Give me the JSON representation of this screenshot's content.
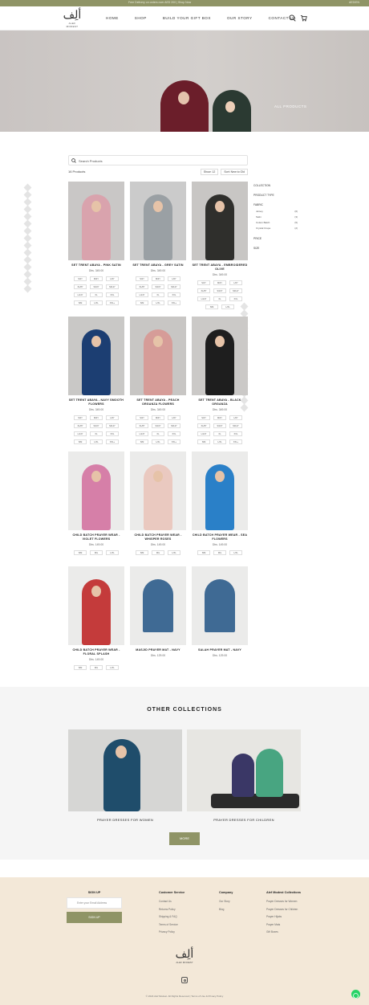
{
  "topbar": {
    "message": "Free Delivery on orders over AED 200 | Shop Now",
    "currency": "AED/EN"
  },
  "header": {
    "logo_arabic": "ألِف",
    "logo_english": "ALEF MODEST",
    "nav": [
      "HOME",
      "SHOP",
      "BUILD YOUR GIFT BOX",
      "OUR STORY",
      "CONTACT US"
    ],
    "icons": [
      "search-icon",
      "cart-icon"
    ]
  },
  "hero": {
    "title": "ALL PRODUCTS"
  },
  "search": {
    "placeholder": "Search Products"
  },
  "listing": {
    "count": "16 Products",
    "sort_label": "Show: 12",
    "sort_order": "Sort: New to Old"
  },
  "filters": {
    "collection": "COLLECTION",
    "product_type": "PRODUCT TYPE",
    "fabric": "FABRIC",
    "fabric_options": [
      {
        "label": "Jersey",
        "count": "(6)"
      },
      {
        "label": "Satin",
        "count": "(3)"
      },
      {
        "label": "Cotton Batch",
        "count": "(5)"
      },
      {
        "label": "Crystal Crepe",
        "count": "(2)"
      }
    ],
    "price": "PRICE",
    "size": "SIZE"
  },
  "products": [
    {
      "name": "SET TRENT ABAYA - PINK SATIN",
      "price": "Dhs. 349.00",
      "sizes": [
        "S/2Y",
        "M/4Y",
        "L/6Y",
        "XL/8Y",
        "S/10Y",
        "M/12Y",
        "L/14Y",
        "XL",
        "XXL",
        "S/M",
        "L/XL",
        "XXL+"
      ],
      "color": "#d9a3ad",
      "bg": "#c9c7c6"
    },
    {
      "name": "SET TRENT ABAYA - GREY SATIN",
      "price": "Dhs. 349.00",
      "sizes": [
        "S/2Y",
        "M/4Y",
        "L/6Y",
        "XL/8Y",
        "S/10Y",
        "M/12Y",
        "L/14Y",
        "XL",
        "XXL",
        "S/M",
        "L/XL",
        "XXL+"
      ],
      "color": "#9aa0a4",
      "bg": "#cbcbcb"
    },
    {
      "name": "SET TRENT ABAYA - EMBROIDERED OLIVE",
      "price": "Dhs. 349.00",
      "sizes": [
        "S/2Y",
        "M/4Y",
        "L/6Y",
        "XL/8Y",
        "S/10Y",
        "M/12Y",
        "L/14Y",
        "XL",
        "XXL",
        "S/M",
        "L/XL"
      ],
      "color": "#2f2f2c",
      "bg": "#c8c6c4"
    },
    {
      "name": "SET TRENT ABAYA - NAVY SMOOTH FLOWERS",
      "price": "Dhs. 349.00",
      "sizes": [
        "S/2Y",
        "M/4Y",
        "L/6Y",
        "XL/8Y",
        "S/10Y",
        "M/12Y",
        "L/14Y",
        "XL",
        "XXL",
        "S/M",
        "L/XL",
        "XXL+"
      ],
      "color": "#1c3e72",
      "bg": "#c9c8c6"
    },
    {
      "name": "SET TRENT ABAYA - PEACH ORGANZA FLOWERS",
      "price": "Dhs. 349.00",
      "sizes": [
        "S/2Y",
        "M/4Y",
        "L/6Y",
        "XL/8Y",
        "S/10Y",
        "M/12Y",
        "L/14Y",
        "XL",
        "XXL",
        "S/M",
        "L/XL",
        "XXL+"
      ],
      "color": "#d69c98",
      "bg": "#c8c6c4"
    },
    {
      "name": "SET TRENT ABAYA - BLACK ORGANZA",
      "price": "Dhs. 349.00",
      "sizes": [
        "S/2Y",
        "M/4Y",
        "L/6Y",
        "XL/8Y",
        "S/10Y",
        "M/12Y",
        "L/14Y",
        "XL",
        "XXL",
        "S/M",
        "L/XL",
        "XXL+"
      ],
      "color": "#1e1e1e",
      "bg": "#cbc9c7"
    },
    {
      "name": "CHILD BATCH PRAYER WEAR - VIOLET FLOWERS",
      "price": "Dhs. 149.00",
      "sizes": [
        "S/M",
        "M/L",
        "L/XL"
      ],
      "color": "#d67fa8",
      "bg": "#ebebea"
    },
    {
      "name": "CHILD BATCH PRAYER WEAR - WHISPER ROSES",
      "price": "Dhs. 149.00",
      "sizes": [
        "S/M",
        "M/L",
        "L/XL"
      ],
      "color": "#eac9c0",
      "bg": "#ebebea"
    },
    {
      "name": "CHILD BATCH PRAYER WEAR - SEA FLOWERS",
      "price": "Dhs. 149.00",
      "sizes": [
        "S/M",
        "M/L",
        "L/XL"
      ],
      "color": "#2a80c8",
      "bg": "#ebebea"
    },
    {
      "name": "CHILD BATCH PRAYER WEAR - FLORAL SPLASH",
      "price": "Dhs. 149.00",
      "sizes": [
        "S/M",
        "M/L",
        "L/XL"
      ],
      "color": "#c43b3b",
      "bg": "#ebebea"
    },
    {
      "name": "MASJID PRAYER MAT - NAVY",
      "price": "Dhs. 129.00",
      "sizes": [],
      "color": "#3f6a94",
      "bg": "#ebebea",
      "mat": true
    },
    {
      "name": "SALAH PRAYER MAT - NAVY",
      "price": "Dhs. 129.00",
      "sizes": [],
      "color": "#3f6a94",
      "bg": "#ebebea",
      "mat": true
    }
  ],
  "other": {
    "title": "OTHER COLLECTIONS",
    "items": [
      {
        "title": "PRAYER DRESSES FOR WOMEN"
      },
      {
        "title": "PRAYER DRESSES FOR CHILDREN"
      }
    ],
    "more": "MORE"
  },
  "footer": {
    "signup_title": "SIGN UP",
    "signup_placeholder": "Enter your Email Address",
    "signup_button": "SIGN UP",
    "columns": [
      {
        "title": "Customer Service",
        "links": [
          "Contact Us",
          "Returns Policy",
          "Shipping & FAQ",
          "Terms of Service",
          "Privacy Policy"
        ]
      },
      {
        "title": "Company",
        "links": [
          "Our Story",
          "Blog"
        ]
      },
      {
        "title": "Alef Modest Collections",
        "links": [
          "Prayer Dresses for Women",
          "Prayer Dresses for Children",
          "Prayer Hijabs",
          "Prayer Mats",
          "Gift Boxes"
        ]
      }
    ],
    "logo_arabic": "ألِف",
    "logo_english": "ALEF MODEST",
    "copyright": "© 2024 Alef Modest. All Rights Reserved | Terms of Use & Privacy Policy"
  }
}
